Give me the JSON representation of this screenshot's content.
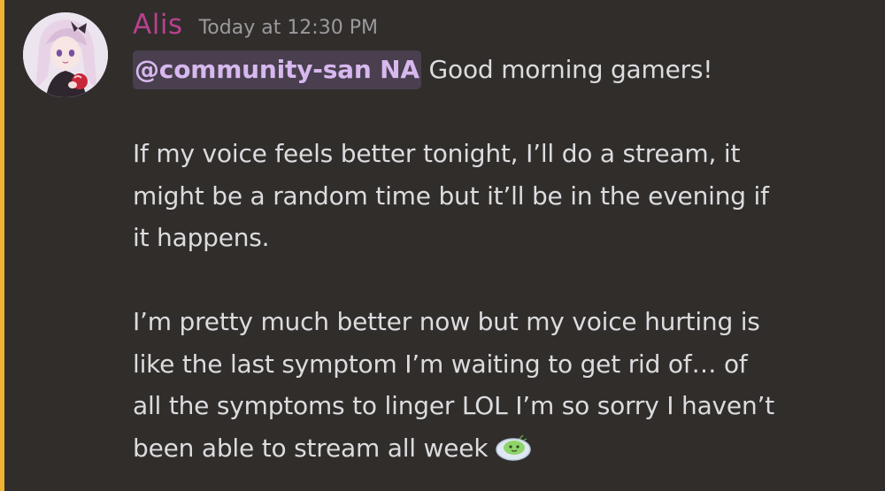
{
  "author": {
    "name": "Alis",
    "avatar_icon": "anime-avatar-icon",
    "name_color": "#b8418f"
  },
  "timestamp": "Today at 12:30 PM",
  "message": {
    "mention": "@community-san NA",
    "line1_rest": " Good morning gamers!",
    "line2": "If my voice feels better tonight, I’ll do a stream, it",
    "line3": "might be a random time but it’ll be in the evening if",
    "line4": "it happens.",
    "line5": "I’m pretty much better now but my voice hurting is",
    "line6": "like the last symptom I’m waiting to get rid of… of",
    "line7": "all the symptoms to linger LOL I’m so sorry I haven’t",
    "line8": "been able to stream all week",
    "emoji_icon": "sick-blob-emoji-icon"
  },
  "colors": {
    "background": "#302d2b",
    "accent_bar": "#f0b232",
    "mention_bg": "#493f4e",
    "mention_text": "#d7b8ef",
    "text": "#dcdcdf",
    "timestamp": "#9b9a9d"
  }
}
